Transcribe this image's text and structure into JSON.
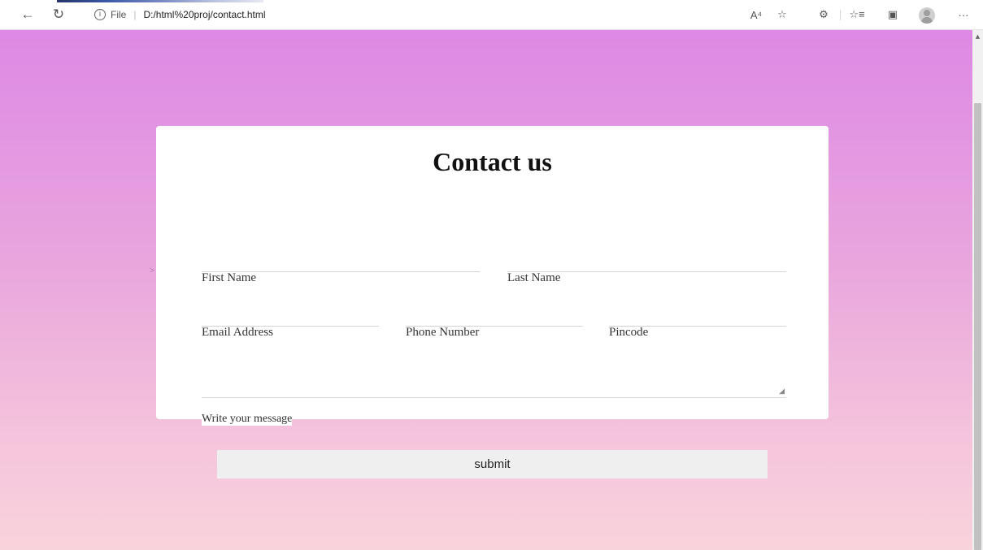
{
  "browser": {
    "back_icon": "←",
    "refresh_icon": "↻",
    "info_icon": "i",
    "scheme": "File",
    "separator": "|",
    "url": "D:/html%20proj/contact.html",
    "read_aloud_icon": "A⁴",
    "add_favorite_icon": "☆",
    "extensions_icon": "⚙",
    "favorites_icon": "☆≡",
    "collections_icon": "▣",
    "more_icon": "···"
  },
  "scroll": {
    "up_arrow": "▲"
  },
  "page": {
    "stray_text": ">",
    "title": "Contact us",
    "fields": {
      "first_name": {
        "label": "First Name",
        "value": ""
      },
      "last_name": {
        "label": "Last Name",
        "value": ""
      },
      "email": {
        "label": "Email Address",
        "value": ""
      },
      "phone": {
        "label": "Phone Number",
        "value": ""
      },
      "pincode": {
        "label": "Pincode",
        "value": ""
      },
      "message": {
        "label": "Write your message",
        "value": ""
      }
    },
    "submit_label": "submit",
    "resize_grip": "◢"
  },
  "colors": {
    "gradient_top": "#dd89e5",
    "gradient_bottom": "#f9d3dc",
    "card_bg": "#ffffff",
    "button_bg": "#efefef"
  }
}
